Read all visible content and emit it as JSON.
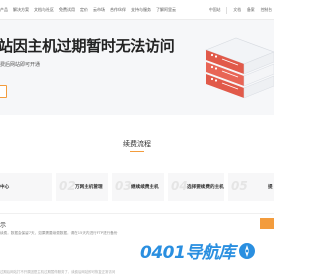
{
  "nav": {
    "items": [
      "产品",
      "解决方案",
      "文档与社区",
      "免费试用",
      "定价",
      "云市场",
      "合作伙伴",
      "支持与服务",
      "了解阿里云"
    ],
    "right": [
      "中国站",
      "文档",
      "备案",
      "控制台"
    ]
  },
  "hero": {
    "title": "站因主机过期暂时无法访问",
    "subtitle": "费后网站即可开通"
  },
  "process": {
    "title": "续费流程",
    "steps": [
      {
        "num": "",
        "label": "中心"
      },
      {
        "num": "02",
        "label": "万网主机管理"
      },
      {
        "num": "03",
        "label": "继续续费主机"
      },
      {
        "num": "04",
        "label": "选择要续费的主机"
      },
      {
        "num": "05",
        "label": "提"
      }
    ]
  },
  "tips": {
    "title": "示",
    "text": "续费，数据会保留7天，如果需要续费数据，请在15天内进行FTP进行备份",
    "bottom": "过期后网站打不开原因是主机过期暂停服务了，续费后网站即可恢复正常访问"
  },
  "watermark": {
    "text": "0401导航库",
    "color": "#2a8fe0"
  },
  "colors": {
    "accent": "#f39c3d",
    "server": "#e15a4a",
    "hero_bg": "#f6f7f9"
  }
}
